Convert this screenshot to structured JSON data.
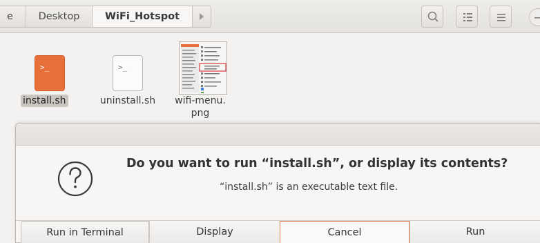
{
  "breadcrumb": {
    "partial_label": "e",
    "items": [
      "Desktop",
      "WiFi_Hotspot"
    ]
  },
  "header_buttons": {
    "search_icon": "search-icon",
    "view_icon": "list-view-icon",
    "menu_icon": "hamburger-menu-icon",
    "minimize_icon": "minimize-icon"
  },
  "files": [
    {
      "name": "install.sh",
      "icon": "terminal-script-icon",
      "glyph": ">_",
      "selected": true
    },
    {
      "name": "uninstall.sh",
      "icon": "terminal-script-icon",
      "glyph": ">_",
      "selected": false
    },
    {
      "name": "wifi-menu.",
      "name_line2": "png",
      "icon": "image-thumbnail",
      "selected": false
    }
  ],
  "dialog": {
    "heading": "Do you want to run “install.sh”, or display its contents?",
    "subtext": "“install.sh” is an executable text file.",
    "icon": "question-icon",
    "buttons": [
      "Run in Terminal",
      "Display",
      "Cancel",
      "Run"
    ]
  },
  "colors": {
    "accent": "#e66f3a",
    "selection": "#c9c5bf",
    "background": "#f4f2f0"
  }
}
